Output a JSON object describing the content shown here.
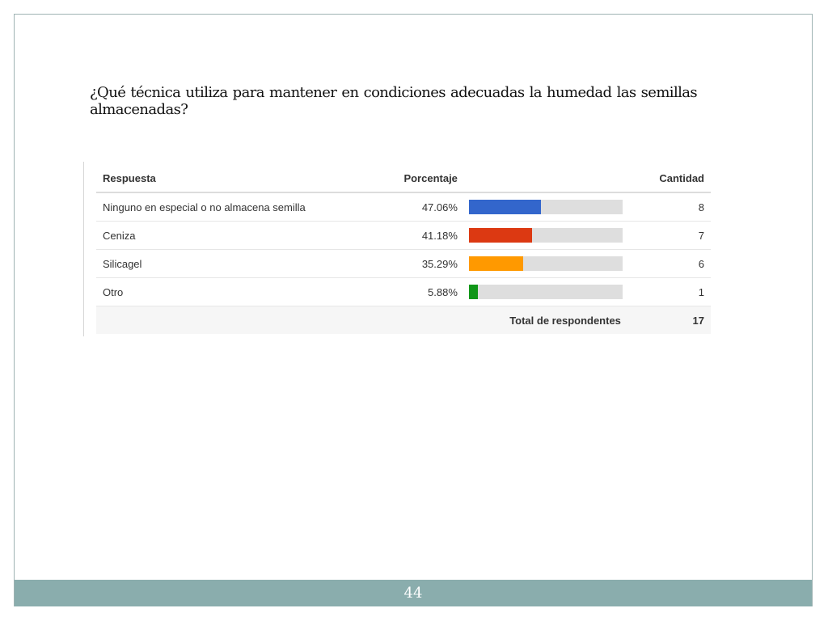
{
  "question": "¿Qué técnica utiliza para mantener en condiciones adecuadas la humedad las semillas almacenadas?",
  "table": {
    "headers": {
      "answer": "Respuesta",
      "percent": "Porcentaje",
      "count": "Cantidad"
    },
    "rows": [
      {
        "answer": "Ninguno en especial o no almacena semilla",
        "percent_label": "47.06%",
        "percent": 47.06,
        "count": "8",
        "color": "#3366cc"
      },
      {
        "answer": "Ceniza",
        "percent_label": "41.18%",
        "percent": 41.18,
        "count": "7",
        "color": "#dc3912"
      },
      {
        "answer": "Silicagel",
        "percent_label": "35.29%",
        "percent": 35.29,
        "count": "6",
        "color": "#ff9900"
      },
      {
        "answer": "Otro",
        "percent_label": "5.88%",
        "percent": 5.88,
        "count": "1",
        "color": "#109618"
      }
    ],
    "total_label": "Total de respondentes",
    "total_value": "17"
  },
  "chart_data": {
    "type": "bar",
    "categories": [
      "Ninguno en especial o no almacena semilla",
      "Ceniza",
      "Silicagel",
      "Otro"
    ],
    "values": [
      47.06,
      41.18,
      35.29,
      5.88
    ],
    "counts": [
      8,
      7,
      6,
      1
    ],
    "total": 17,
    "orientation": "horizontal",
    "xlim": [
      0,
      100
    ],
    "colors": [
      "#3366cc",
      "#dc3912",
      "#ff9900",
      "#109618"
    ]
  },
  "footer": {
    "page_number": "44"
  }
}
